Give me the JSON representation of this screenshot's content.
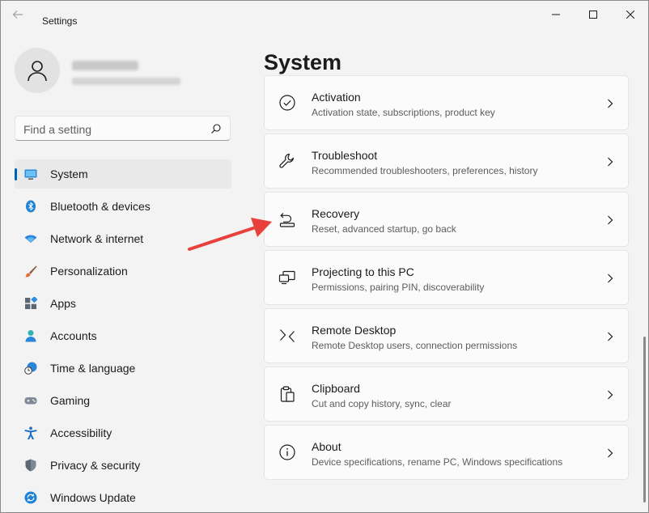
{
  "app": {
    "title": "Settings"
  },
  "search": {
    "placeholder": "Find a setting"
  },
  "nav": {
    "items": [
      {
        "label": "System",
        "icon": "system-icon",
        "selected": true
      },
      {
        "label": "Bluetooth & devices",
        "icon": "bluetooth-icon"
      },
      {
        "label": "Network & internet",
        "icon": "wifi-icon"
      },
      {
        "label": "Personalization",
        "icon": "brush-icon"
      },
      {
        "label": "Apps",
        "icon": "apps-icon"
      },
      {
        "label": "Accounts",
        "icon": "person-icon"
      },
      {
        "label": "Time & language",
        "icon": "globe-clock-icon"
      },
      {
        "label": "Gaming",
        "icon": "gamepad-icon"
      },
      {
        "label": "Accessibility",
        "icon": "accessibility-icon"
      },
      {
        "label": "Privacy & security",
        "icon": "shield-icon"
      },
      {
        "label": "Windows Update",
        "icon": "update-icon"
      }
    ]
  },
  "main": {
    "title": "System",
    "cards": [
      {
        "title": "Activation",
        "desc": "Activation state, subscriptions, product key",
        "icon": "checkmark-circle-icon"
      },
      {
        "title": "Troubleshoot",
        "desc": "Recommended troubleshooters, preferences, history",
        "icon": "wrench-icon"
      },
      {
        "title": "Recovery",
        "desc": "Reset, advanced startup, go back",
        "icon": "recovery-icon"
      },
      {
        "title": "Projecting to this PC",
        "desc": "Permissions, pairing PIN, discoverability",
        "icon": "projection-icon"
      },
      {
        "title": "Remote Desktop",
        "desc": "Remote Desktop users, connection permissions",
        "icon": "remote-desktop-icon"
      },
      {
        "title": "Clipboard",
        "desc": "Cut and copy history, sync, clear",
        "icon": "clipboard-icon"
      },
      {
        "title": "About",
        "desc": "Device specifications, rename PC, Windows specifications",
        "icon": "info-icon"
      }
    ]
  },
  "colors": {
    "accent": "#005fb8",
    "annotation_arrow": "#e8413c",
    "background": "#f3f3f3",
    "card": "#fbfbfb"
  }
}
